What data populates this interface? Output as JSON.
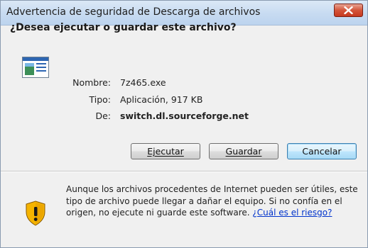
{
  "window": {
    "title": "Advertencia de seguridad de Descarga de archivos",
    "close_icon": "close-icon"
  },
  "prompt": {
    "question": "¿Desea ejecutar o guardar este archivo?"
  },
  "file": {
    "icon": "application-file-icon",
    "name_label": "Nombre:",
    "name_value": "7z465.exe",
    "type_label": "Tipo:",
    "type_value": "Aplicación, 917 KB",
    "from_label": "De:",
    "from_value": "switch.dl.sourceforge.net"
  },
  "buttons": {
    "run": "Ejecutar",
    "save": "Guardar",
    "cancel": "Cancelar"
  },
  "warning": {
    "icon": "shield-warning-icon",
    "text": "Aunque los archivos procedentes de Internet pueden ser útiles, este tipo de archivo puede llegar a dañar el equipo. Si no confía en el origen, no ejecute ni guarde este software. ",
    "link": "¿Cuál es el riesgo?"
  },
  "colors": {
    "link": "#0033cc",
    "close_button": "#c6391f"
  }
}
